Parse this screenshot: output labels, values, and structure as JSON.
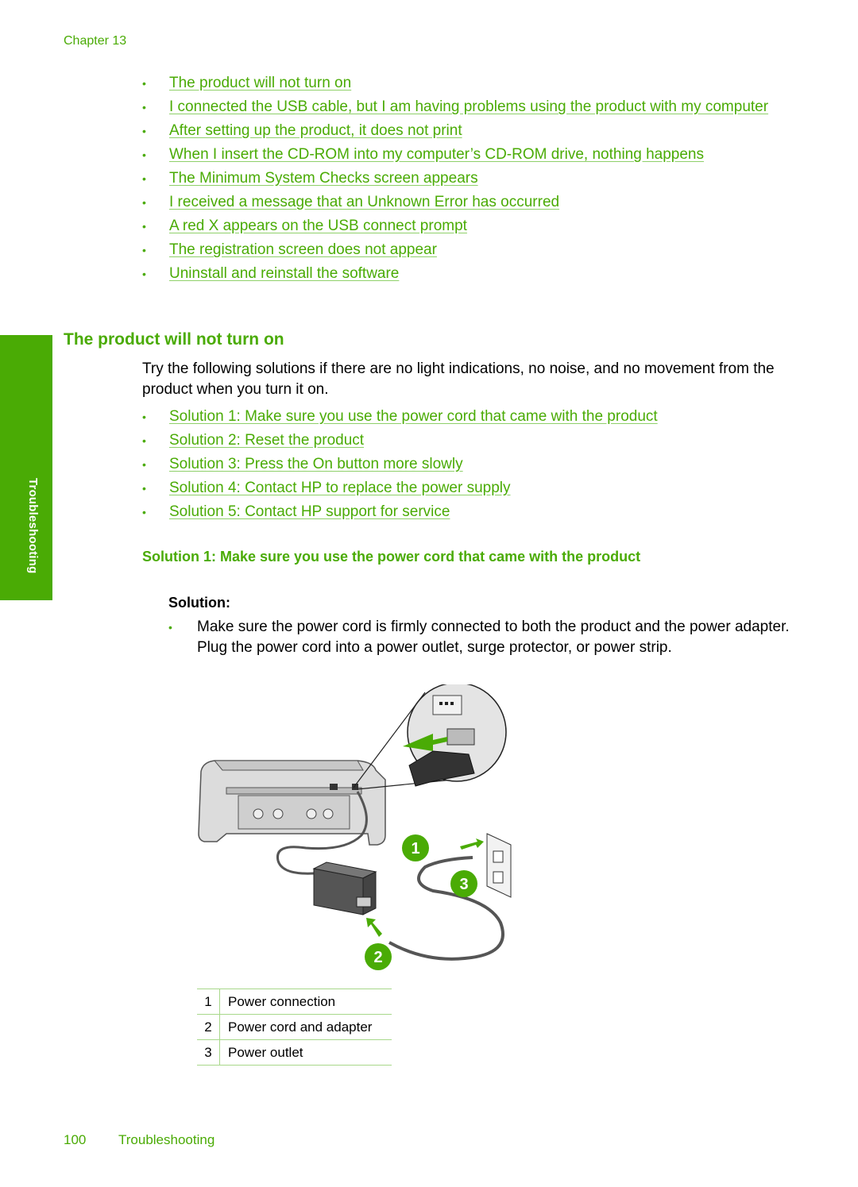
{
  "header": {
    "chapter": "Chapter 13"
  },
  "toc_links": [
    "The product will not turn on",
    "I connected the USB cable, but I am having problems using the product with my computer",
    "After setting up the product, it does not print",
    "When I insert the CD-ROM into my computer’s CD-ROM drive, nothing happens",
    "The Minimum System Checks screen appears",
    "I received a message that an Unknown Error has occurred",
    "A red X appears on the USB connect prompt",
    "The registration screen does not appear",
    "Uninstall and reinstall the software"
  ],
  "side_tab": {
    "label": "Troubleshooting"
  },
  "section": {
    "title": "The product will not turn on",
    "intro": "Try the following solutions if there are no light indications, no noise, and no movement from the product when you turn it on.",
    "solution_links": [
      "Solution 1: Make sure you use the power cord that came with the product",
      "Solution 2: Reset the product",
      "Solution 3: Press the On button more slowly",
      "Solution 4: Contact HP to replace the power supply",
      "Solution 5: Contact HP support for service"
    ],
    "solution1": {
      "heading": "Solution 1: Make sure you use the power cord that came with the product",
      "label": "Solution:",
      "text": "Make sure the power cord is firmly connected to both the product and the power adapter. Plug the power cord into a power outlet, surge protector, or power strip."
    }
  },
  "figure": {
    "callouts": [
      "1",
      "2",
      "3"
    ],
    "accent": "#4aab05"
  },
  "legend": [
    {
      "num": "1",
      "text": "Power connection"
    },
    {
      "num": "2",
      "text": "Power cord and adapter"
    },
    {
      "num": "3",
      "text": "Power outlet"
    }
  ],
  "footer": {
    "page": "100",
    "title": "Troubleshooting"
  },
  "colors": {
    "accent": "#4aab05",
    "text": "#000000"
  }
}
